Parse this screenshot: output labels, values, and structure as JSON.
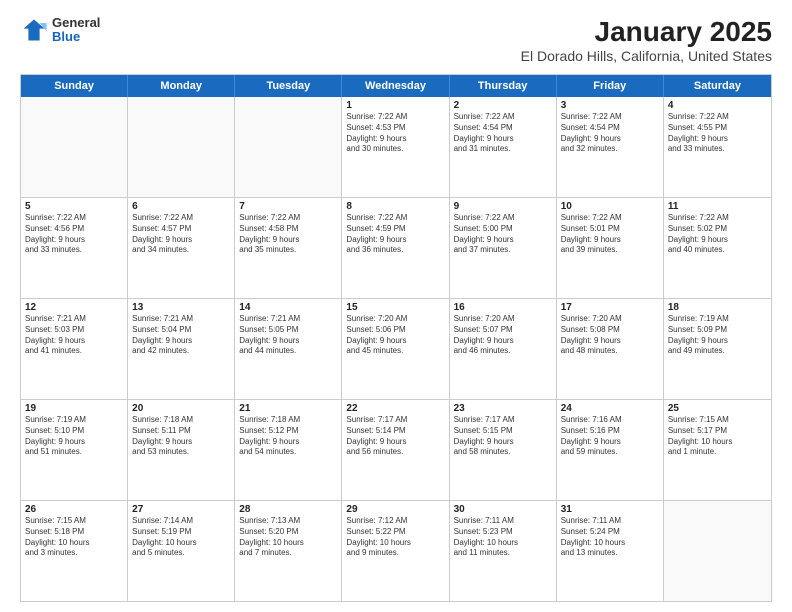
{
  "header": {
    "logo_general": "General",
    "logo_blue": "Blue",
    "title": "January 2025",
    "subtitle": "El Dorado Hills, California, United States"
  },
  "calendar": {
    "days": [
      "Sunday",
      "Monday",
      "Tuesday",
      "Wednesday",
      "Thursday",
      "Friday",
      "Saturday"
    ],
    "rows": [
      [
        {
          "day": "",
          "content": ""
        },
        {
          "day": "",
          "content": ""
        },
        {
          "day": "",
          "content": ""
        },
        {
          "day": "1",
          "content": "Sunrise: 7:22 AM\nSunset: 4:53 PM\nDaylight: 9 hours\nand 30 minutes."
        },
        {
          "day": "2",
          "content": "Sunrise: 7:22 AM\nSunset: 4:54 PM\nDaylight: 9 hours\nand 31 minutes."
        },
        {
          "day": "3",
          "content": "Sunrise: 7:22 AM\nSunset: 4:54 PM\nDaylight: 9 hours\nand 32 minutes."
        },
        {
          "day": "4",
          "content": "Sunrise: 7:22 AM\nSunset: 4:55 PM\nDaylight: 9 hours\nand 33 minutes."
        }
      ],
      [
        {
          "day": "5",
          "content": "Sunrise: 7:22 AM\nSunset: 4:56 PM\nDaylight: 9 hours\nand 33 minutes."
        },
        {
          "day": "6",
          "content": "Sunrise: 7:22 AM\nSunset: 4:57 PM\nDaylight: 9 hours\nand 34 minutes."
        },
        {
          "day": "7",
          "content": "Sunrise: 7:22 AM\nSunset: 4:58 PM\nDaylight: 9 hours\nand 35 minutes."
        },
        {
          "day": "8",
          "content": "Sunrise: 7:22 AM\nSunset: 4:59 PM\nDaylight: 9 hours\nand 36 minutes."
        },
        {
          "day": "9",
          "content": "Sunrise: 7:22 AM\nSunset: 5:00 PM\nDaylight: 9 hours\nand 37 minutes."
        },
        {
          "day": "10",
          "content": "Sunrise: 7:22 AM\nSunset: 5:01 PM\nDaylight: 9 hours\nand 39 minutes."
        },
        {
          "day": "11",
          "content": "Sunrise: 7:22 AM\nSunset: 5:02 PM\nDaylight: 9 hours\nand 40 minutes."
        }
      ],
      [
        {
          "day": "12",
          "content": "Sunrise: 7:21 AM\nSunset: 5:03 PM\nDaylight: 9 hours\nand 41 minutes."
        },
        {
          "day": "13",
          "content": "Sunrise: 7:21 AM\nSunset: 5:04 PM\nDaylight: 9 hours\nand 42 minutes."
        },
        {
          "day": "14",
          "content": "Sunrise: 7:21 AM\nSunset: 5:05 PM\nDaylight: 9 hours\nand 44 minutes."
        },
        {
          "day": "15",
          "content": "Sunrise: 7:20 AM\nSunset: 5:06 PM\nDaylight: 9 hours\nand 45 minutes."
        },
        {
          "day": "16",
          "content": "Sunrise: 7:20 AM\nSunset: 5:07 PM\nDaylight: 9 hours\nand 46 minutes."
        },
        {
          "day": "17",
          "content": "Sunrise: 7:20 AM\nSunset: 5:08 PM\nDaylight: 9 hours\nand 48 minutes."
        },
        {
          "day": "18",
          "content": "Sunrise: 7:19 AM\nSunset: 5:09 PM\nDaylight: 9 hours\nand 49 minutes."
        }
      ],
      [
        {
          "day": "19",
          "content": "Sunrise: 7:19 AM\nSunset: 5:10 PM\nDaylight: 9 hours\nand 51 minutes."
        },
        {
          "day": "20",
          "content": "Sunrise: 7:18 AM\nSunset: 5:11 PM\nDaylight: 9 hours\nand 53 minutes."
        },
        {
          "day": "21",
          "content": "Sunrise: 7:18 AM\nSunset: 5:12 PM\nDaylight: 9 hours\nand 54 minutes."
        },
        {
          "day": "22",
          "content": "Sunrise: 7:17 AM\nSunset: 5:14 PM\nDaylight: 9 hours\nand 56 minutes."
        },
        {
          "day": "23",
          "content": "Sunrise: 7:17 AM\nSunset: 5:15 PM\nDaylight: 9 hours\nand 58 minutes."
        },
        {
          "day": "24",
          "content": "Sunrise: 7:16 AM\nSunset: 5:16 PM\nDaylight: 9 hours\nand 59 minutes."
        },
        {
          "day": "25",
          "content": "Sunrise: 7:15 AM\nSunset: 5:17 PM\nDaylight: 10 hours\nand 1 minute."
        }
      ],
      [
        {
          "day": "26",
          "content": "Sunrise: 7:15 AM\nSunset: 5:18 PM\nDaylight: 10 hours\nand 3 minutes."
        },
        {
          "day": "27",
          "content": "Sunrise: 7:14 AM\nSunset: 5:19 PM\nDaylight: 10 hours\nand 5 minutes."
        },
        {
          "day": "28",
          "content": "Sunrise: 7:13 AM\nSunset: 5:20 PM\nDaylight: 10 hours\nand 7 minutes."
        },
        {
          "day": "29",
          "content": "Sunrise: 7:12 AM\nSunset: 5:22 PM\nDaylight: 10 hours\nand 9 minutes."
        },
        {
          "day": "30",
          "content": "Sunrise: 7:11 AM\nSunset: 5:23 PM\nDaylight: 10 hours\nand 11 minutes."
        },
        {
          "day": "31",
          "content": "Sunrise: 7:11 AM\nSunset: 5:24 PM\nDaylight: 10 hours\nand 13 minutes."
        },
        {
          "day": "",
          "content": ""
        }
      ]
    ]
  }
}
